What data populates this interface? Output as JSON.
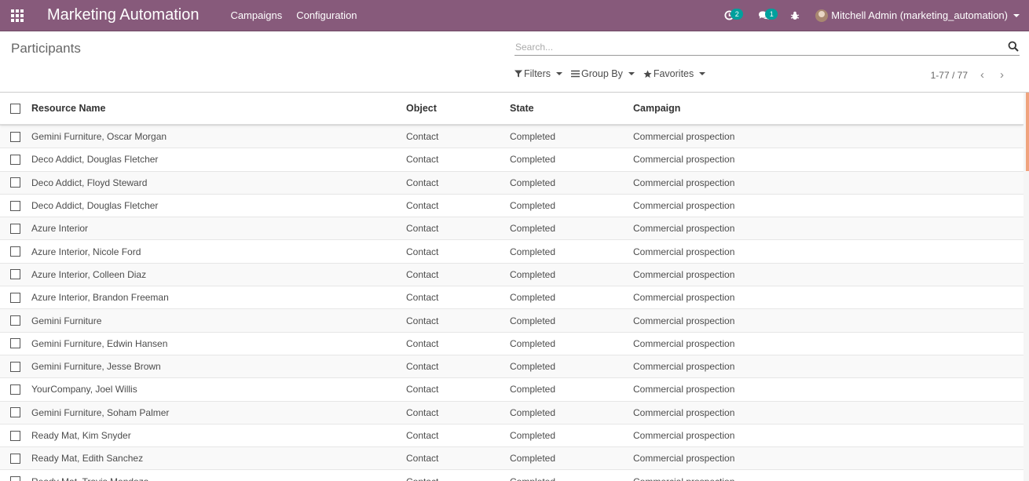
{
  "navbar": {
    "app_title": "Marketing Automation",
    "menu": [
      "Campaigns",
      "Configuration"
    ],
    "activity_count": "2",
    "messages_count": "1",
    "user_name": "Mitchell Admin (marketing_automation)"
  },
  "control_panel": {
    "breadcrumb": "Participants",
    "search_placeholder": "Search...",
    "filters_label": "Filters",
    "groupby_label": "Group By",
    "favorites_label": "Favorites",
    "pager_value": "1-77 / 77"
  },
  "table": {
    "headers": {
      "name": "Resource Name",
      "object": "Object",
      "state": "State",
      "campaign": "Campaign"
    },
    "rows": [
      {
        "name": "Gemini Furniture, Oscar Morgan",
        "object": "Contact",
        "state": "Completed",
        "campaign": "Commercial prospection"
      },
      {
        "name": "Deco Addict, Douglas Fletcher",
        "object": "Contact",
        "state": "Completed",
        "campaign": "Commercial prospection"
      },
      {
        "name": "Deco Addict, Floyd Steward",
        "object": "Contact",
        "state": "Completed",
        "campaign": "Commercial prospection"
      },
      {
        "name": "Deco Addict, Douglas Fletcher",
        "object": "Contact",
        "state": "Completed",
        "campaign": "Commercial prospection"
      },
      {
        "name": "Azure Interior",
        "object": "Contact",
        "state": "Completed",
        "campaign": "Commercial prospection"
      },
      {
        "name": "Azure Interior, Nicole Ford",
        "object": "Contact",
        "state": "Completed",
        "campaign": "Commercial prospection"
      },
      {
        "name": "Azure Interior, Colleen Diaz",
        "object": "Contact",
        "state": "Completed",
        "campaign": "Commercial prospection"
      },
      {
        "name": "Azure Interior, Brandon Freeman",
        "object": "Contact",
        "state": "Completed",
        "campaign": "Commercial prospection"
      },
      {
        "name": "Gemini Furniture",
        "object": "Contact",
        "state": "Completed",
        "campaign": "Commercial prospection"
      },
      {
        "name": "Gemini Furniture, Edwin Hansen",
        "object": "Contact",
        "state": "Completed",
        "campaign": "Commercial prospection"
      },
      {
        "name": "Gemini Furniture, Jesse Brown",
        "object": "Contact",
        "state": "Completed",
        "campaign": "Commercial prospection"
      },
      {
        "name": "YourCompany, Joel Willis",
        "object": "Contact",
        "state": "Completed",
        "campaign": "Commercial prospection"
      },
      {
        "name": "Gemini Furniture, Soham Palmer",
        "object": "Contact",
        "state": "Completed",
        "campaign": "Commercial prospection"
      },
      {
        "name": "Ready Mat, Kim Snyder",
        "object": "Contact",
        "state": "Completed",
        "campaign": "Commercial prospection"
      },
      {
        "name": "Ready Mat, Edith Sanchez",
        "object": "Contact",
        "state": "Completed",
        "campaign": "Commercial prospection"
      },
      {
        "name": "Ready Mat, Travis Mendoza",
        "object": "Contact",
        "state": "Completed",
        "campaign": "Commercial prospection"
      }
    ]
  }
}
